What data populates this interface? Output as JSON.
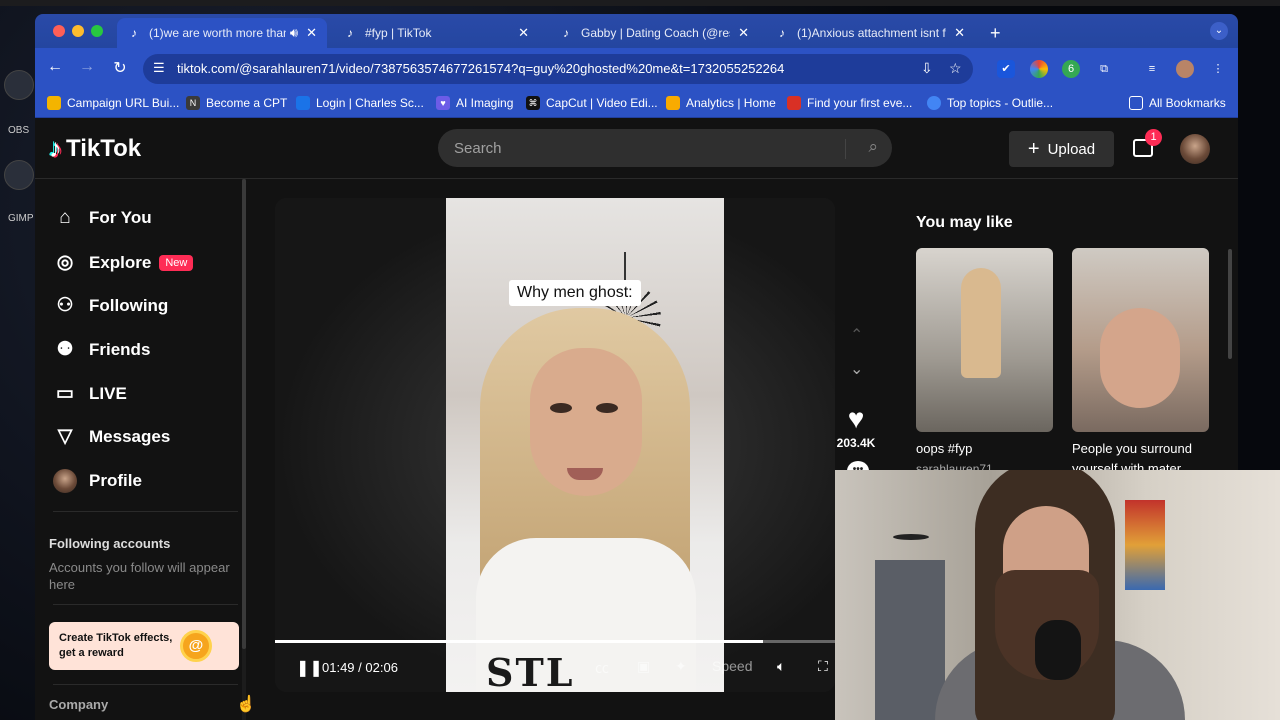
{
  "desktop": {
    "left_labels": [
      "OBS",
      "GIMP"
    ]
  },
  "browser": {
    "tabs": [
      {
        "title": "(1)we are worth more than",
        "active": true
      },
      {
        "title": "#fyp | TikTok",
        "active": false
      },
      {
        "title": "Gabby | Dating Coach (@resp",
        "active": false
      },
      {
        "title": "(1)Anxious attachment isnt fo",
        "active": false
      }
    ],
    "url": "tiktok.com/@sarahlauren71/video/7387563574677261574?q=guy%20ghosted%20me&t=1732055252264",
    "extension_badge": "6",
    "bookmarks": [
      {
        "label": "Campaign URL Bui...",
        "color": "#f4b400"
      },
      {
        "label": "Become a CPT",
        "color": "#3a3a3a"
      },
      {
        "label": "Login | Charles Sc...",
        "color": "#1a73e8"
      },
      {
        "label": "AI Imaging",
        "color": "#6c5ce7"
      },
      {
        "label": "CapCut | Video Edi...",
        "color": "#111111"
      },
      {
        "label": "Analytics | Home",
        "color": "#f9ab00"
      },
      {
        "label": "Find your first eve...",
        "color": "#d93025"
      },
      {
        "label": "Top topics - Outlie...",
        "color": "#4285f4"
      }
    ],
    "all_bookmarks": "All Bookmarks"
  },
  "tiktok": {
    "logo": "TikTok",
    "search_placeholder": "Search",
    "upload": "Upload",
    "inbox_badge": "1",
    "nav": [
      {
        "label": "For You",
        "icon": "home-icon",
        "glyph": "⌂"
      },
      {
        "label": "Explore",
        "icon": "compass-icon",
        "glyph": "◎",
        "badge": "New"
      },
      {
        "label": "Following",
        "icon": "following-icon",
        "glyph": "⚇"
      },
      {
        "label": "Friends",
        "icon": "friends-icon",
        "glyph": "⚉"
      },
      {
        "label": "LIVE",
        "icon": "live-icon",
        "glyph": "▭"
      },
      {
        "label": "Messages",
        "icon": "messages-icon",
        "glyph": "▽"
      },
      {
        "label": "Profile",
        "icon": "profile-avatar",
        "glyph": ""
      }
    ],
    "following_accounts": {
      "heading": "Following accounts",
      "text": "Accounts you follow will appear here"
    },
    "effects_banner": "Create TikTok effects, get a reward",
    "company": "Company",
    "video": {
      "caption": "Why men ghost:",
      "shirt_text": "STL",
      "time_current": "01:49",
      "time_total": "02:06",
      "progress": 0.872,
      "speed_label": "Speed",
      "likes": "203.4K",
      "author": "sarahlauren71"
    },
    "recommendations": {
      "title": "You may like",
      "items": [
        {
          "caption": "oops #fyp",
          "user": "sarahlauren71"
        },
        {
          "caption": "People you surround yourself with mater...",
          "user": ""
        }
      ]
    }
  }
}
